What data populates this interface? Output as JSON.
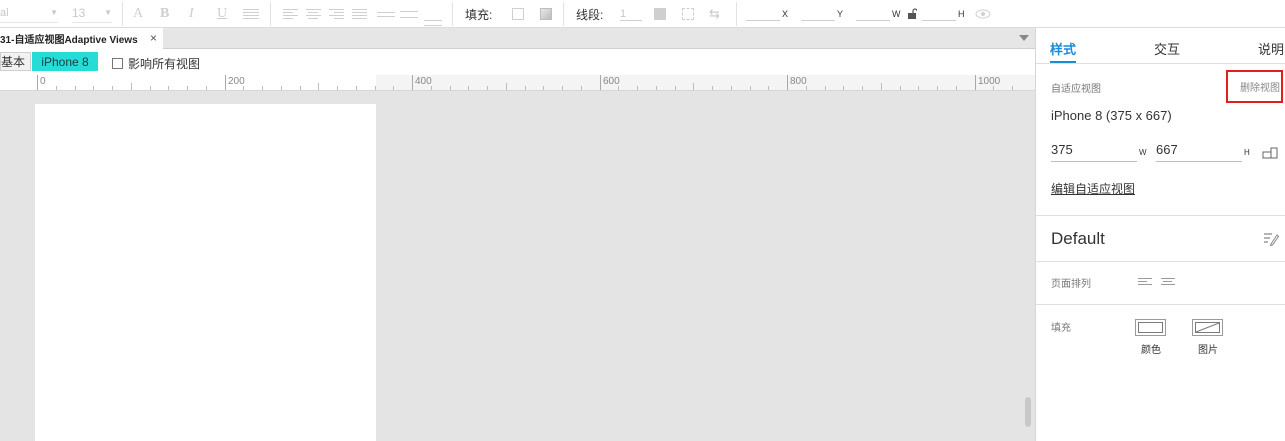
{
  "toolbar": {
    "font_family": "al",
    "font_size": "13",
    "fill_label": "填充:",
    "line_label": "线段:",
    "line_width": "1",
    "x_label": "X",
    "y_label": "Y",
    "w_label": "W",
    "h_label": "H"
  },
  "document_tab": {
    "title": "31-自适应视图Adaptive Views",
    "close": "×"
  },
  "viewbar": {
    "base_view": "基本",
    "active_view": "iPhone 8",
    "affect_all": "影响所有视图",
    "active_color": "#26dcd6"
  },
  "ruler": {
    "labels": [
      "0",
      "200",
      "400",
      "600",
      "800",
      "1000"
    ]
  },
  "inspector": {
    "tabs": [
      "样式",
      "交互",
      "说明"
    ],
    "active_tab": "样式",
    "adaptive_section_label": "自适应视图",
    "delete_view": "删除视图",
    "view_name": "iPhone 8 (375 x 667)",
    "width_value": "375",
    "width_unit": "W",
    "height_value": "667",
    "height_unit": "H",
    "edit_views_link": "编辑自适应视图",
    "style_name": "Default",
    "page_align_label": "页面排列",
    "fill_label": "填充",
    "fill_color_caption": "颜色",
    "fill_image_caption": "图片",
    "accent_color": "#1a8cd8",
    "highlight_color": "#e0201a"
  }
}
